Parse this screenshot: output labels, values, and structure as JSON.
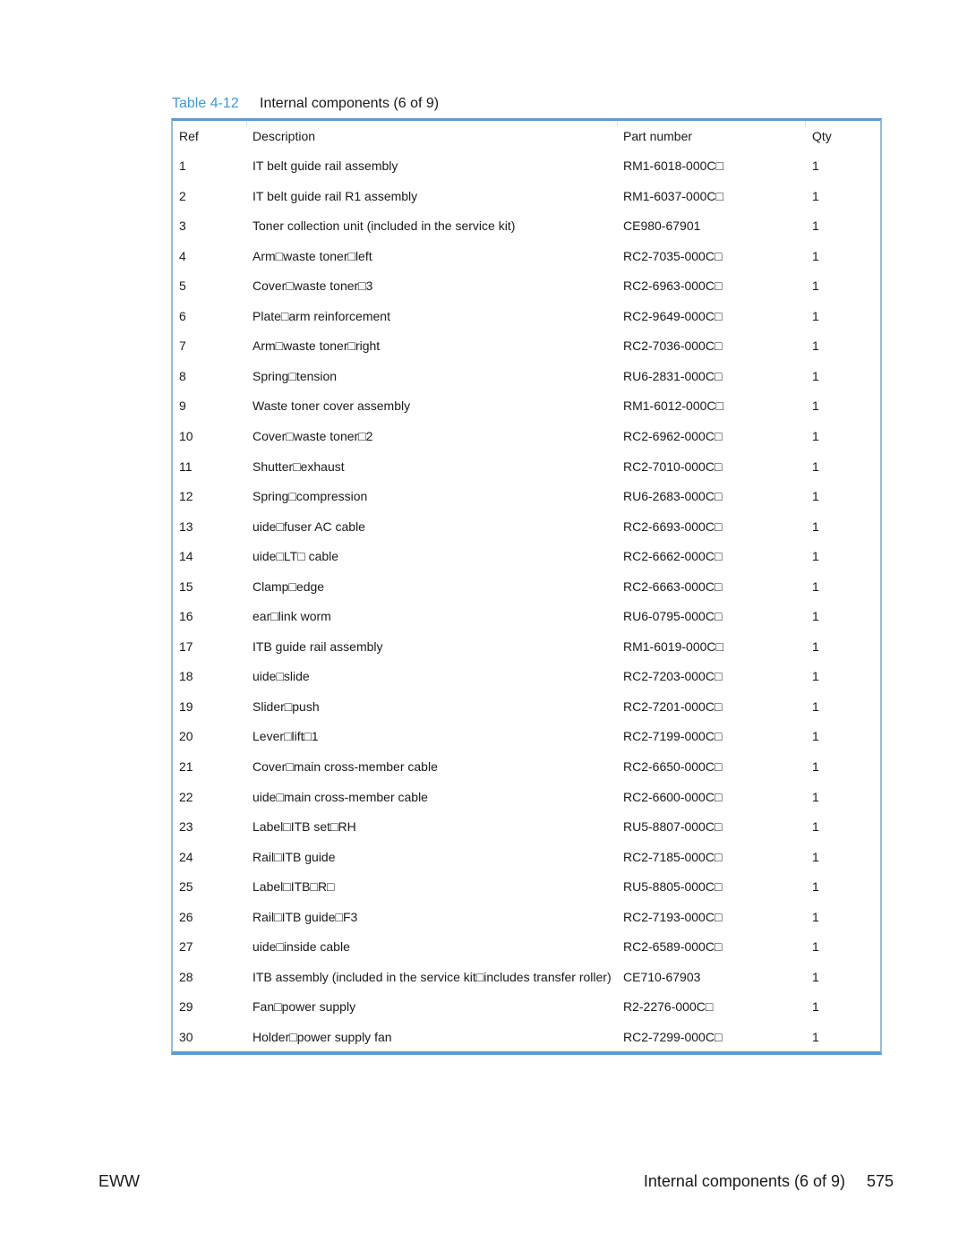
{
  "caption": {
    "number": "Table 4-12",
    "title": "Internal components (6 of 9)"
  },
  "table": {
    "headers": {
      "ref": "Ref",
      "description": "Description",
      "part_number": "Part number",
      "qty": "Qty"
    },
    "rows": [
      {
        "ref": "1",
        "description": "IT belt guide rail assembly",
        "part_number": "RM1-6018-000C□",
        "qty": "1"
      },
      {
        "ref": "2",
        "description": "IT belt guide rail R1 assembly",
        "part_number": "RM1-6037-000C□",
        "qty": "1"
      },
      {
        "ref": "3",
        "description": "Toner collection unit (included in the service kit)",
        "part_number": "CE980-67901",
        "qty": "1"
      },
      {
        "ref": "4",
        "description": "Arm□waste toner□left",
        "part_number": "RC2-7035-000C□",
        "qty": "1"
      },
      {
        "ref": "5",
        "description": "Cover□waste toner□3",
        "part_number": "RC2-6963-000C□",
        "qty": "1"
      },
      {
        "ref": "6",
        "description": "Plate□arm reinforcement",
        "part_number": "RC2-9649-000C□",
        "qty": "1"
      },
      {
        "ref": "7",
        "description": "Arm□waste toner□right",
        "part_number": "RC2-7036-000C□",
        "qty": "1"
      },
      {
        "ref": "8",
        "description": "Spring□tension",
        "part_number": "RU6-2831-000C□",
        "qty": "1"
      },
      {
        "ref": "9",
        "description": "Waste toner cover assembly",
        "part_number": "RM1-6012-000C□",
        "qty": "1"
      },
      {
        "ref": "10",
        "description": "Cover□waste toner□2",
        "part_number": "RC2-6962-000C□",
        "qty": "1"
      },
      {
        "ref": "11",
        "description": "Shutter□exhaust",
        "part_number": "RC2-7010-000C□",
        "qty": "1"
      },
      {
        "ref": "12",
        "description": "Spring□compression",
        "part_number": "RU6-2683-000C□",
        "qty": "1"
      },
      {
        "ref": "13",
        "description": "uide□fuser AC cable",
        "part_number": "RC2-6693-000C□",
        "qty": "1"
      },
      {
        "ref": "14",
        "description": "uide□LT□ cable",
        "part_number": "RC2-6662-000C□",
        "qty": "1"
      },
      {
        "ref": "15",
        "description": "Clamp□edge",
        "part_number": "RC2-6663-000C□",
        "qty": "1"
      },
      {
        "ref": "16",
        "description": "ear□link worm",
        "part_number": "RU6-0795-000C□",
        "qty": "1"
      },
      {
        "ref": "17",
        "description": "ITB guide rail assembly",
        "part_number": "RM1-6019-000C□",
        "qty": "1"
      },
      {
        "ref": "18",
        "description": "uide□slide",
        "part_number": "RC2-7203-000C□",
        "qty": "1"
      },
      {
        "ref": "19",
        "description": "Slider□push",
        "part_number": "RC2-7201-000C□",
        "qty": "1"
      },
      {
        "ref": "20",
        "description": "Lever□lift□1",
        "part_number": "RC2-7199-000C□",
        "qty": "1"
      },
      {
        "ref": "21",
        "description": "Cover□main cross-member cable",
        "part_number": "RC2-6650-000C□",
        "qty": "1"
      },
      {
        "ref": "22",
        "description": "uide□main cross-member cable",
        "part_number": "RC2-6600-000C□",
        "qty": "1"
      },
      {
        "ref": "23",
        "description": "Label□ITB set□RH",
        "part_number": "RU5-8807-000C□",
        "qty": "1"
      },
      {
        "ref": "24",
        "description": "Rail□ITB guide",
        "part_number": "RC2-7185-000C□",
        "qty": "1"
      },
      {
        "ref": "25",
        "description": "Label□ITB□R□",
        "part_number": "RU5-8805-000C□",
        "qty": "1"
      },
      {
        "ref": "26",
        "description": "Rail□ITB guide□F3",
        "part_number": "RC2-7193-000C□",
        "qty": "1"
      },
      {
        "ref": "27",
        "description": "uide□inside cable",
        "part_number": "RC2-6589-000C□",
        "qty": "1"
      },
      {
        "ref": "28",
        "description": "ITB assembly (included in the service kit□includes transfer roller)",
        "part_number": "CE710-67903",
        "qty": "1"
      },
      {
        "ref": "29",
        "description": "Fan□power supply",
        "part_number": "R2-2276-000C□",
        "qty": "1"
      },
      {
        "ref": "30",
        "description": "Holder□power supply fan",
        "part_number": "RC2-7299-000C□",
        "qty": "1"
      }
    ]
  },
  "footer": {
    "left": "EWW",
    "section": "Internal components (6 of 9)",
    "page": "575"
  }
}
